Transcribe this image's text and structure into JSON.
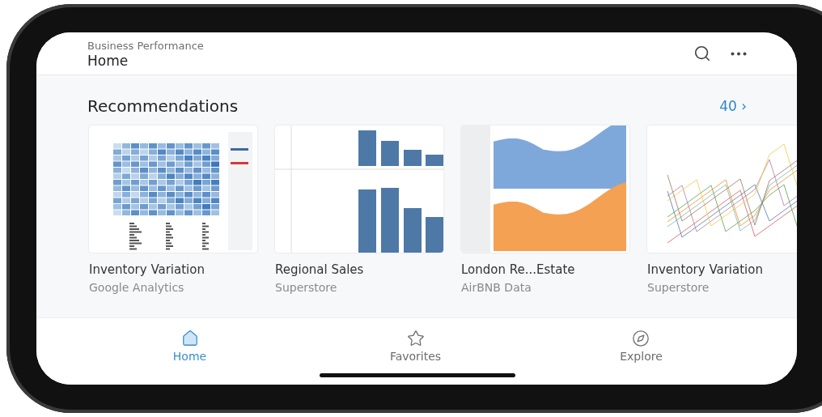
{
  "header": {
    "subtitle": "Business Performance",
    "title": "Home"
  },
  "section": {
    "title": "Recommendations",
    "count": "40",
    "chevron": "›"
  },
  "cards": [
    {
      "title": "Inventory Variation",
      "source": "Google Analytics",
      "kind": "heatmap"
    },
    {
      "title": "Regional Sales",
      "source": "Superstore",
      "kind": "bars"
    },
    {
      "title": "London Re...Estate",
      "source": "AirBNB Data",
      "kind": "area"
    },
    {
      "title": "Inventory Variation",
      "source": "Superstore",
      "kind": "lines"
    }
  ],
  "tabs": [
    {
      "label": "Home",
      "selected": true
    },
    {
      "label": "Favorites",
      "selected": false
    },
    {
      "label": "Explore",
      "selected": false
    }
  ]
}
